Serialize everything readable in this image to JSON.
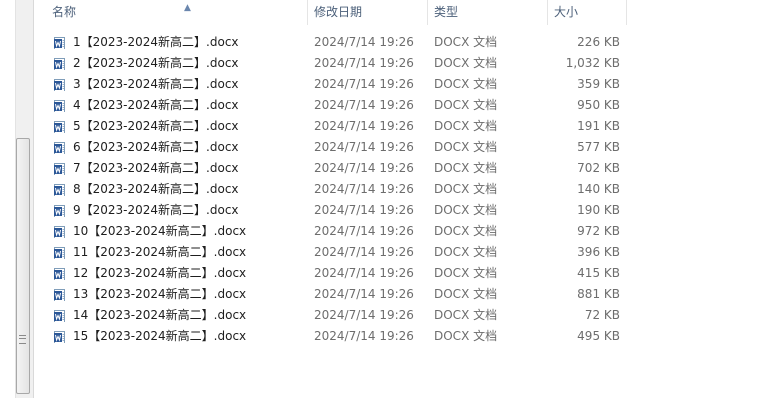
{
  "header": {
    "name_label": "名称",
    "date_label": "修改日期",
    "type_label": "类型",
    "size_label": "大小"
  },
  "files": [
    {
      "name": "1【2023-2024新高二】.docx",
      "date": "2024/7/14 19:26",
      "type": "DOCX 文档",
      "size": "226 KB"
    },
    {
      "name": "2【2023-2024新高二】.docx",
      "date": "2024/7/14 19:26",
      "type": "DOCX 文档",
      "size": "1,032 KB"
    },
    {
      "name": "3【2023-2024新高二】.docx",
      "date": "2024/7/14 19:26",
      "type": "DOCX 文档",
      "size": "359 KB"
    },
    {
      "name": "4【2023-2024新高二】.docx",
      "date": "2024/7/14 19:26",
      "type": "DOCX 文档",
      "size": "950 KB"
    },
    {
      "name": "5【2023-2024新高二】.docx",
      "date": "2024/7/14 19:26",
      "type": "DOCX 文档",
      "size": "191 KB"
    },
    {
      "name": "6【2023-2024新高二】.docx",
      "date": "2024/7/14 19:26",
      "type": "DOCX 文档",
      "size": "577 KB"
    },
    {
      "name": "7【2023-2024新高二】.docx",
      "date": "2024/7/14 19:26",
      "type": "DOCX 文档",
      "size": "702 KB"
    },
    {
      "name": "8【2023-2024新高二】.docx",
      "date": "2024/7/14 19:26",
      "type": "DOCX 文档",
      "size": "140 KB"
    },
    {
      "name": "9【2023-2024新高二】.docx",
      "date": "2024/7/14 19:26",
      "type": "DOCX 文档",
      "size": "190 KB"
    },
    {
      "name": "10【2023-2024新高二】.docx",
      "date": "2024/7/14 19:26",
      "type": "DOCX 文档",
      "size": "972 KB"
    },
    {
      "name": "11【2023-2024新高二】.docx",
      "date": "2024/7/14 19:26",
      "type": "DOCX 文档",
      "size": "396 KB"
    },
    {
      "name": "12【2023-2024新高二】.docx",
      "date": "2024/7/14 19:26",
      "type": "DOCX 文档",
      "size": "415 KB"
    },
    {
      "name": "13【2023-2024新高二】.docx",
      "date": "2024/7/14 19:26",
      "type": "DOCX 文档",
      "size": "881 KB"
    },
    {
      "name": "14【2023-2024新高二】.docx",
      "date": "2024/7/14 19:26",
      "type": "DOCX 文档",
      "size": "72 KB"
    },
    {
      "name": "15【2023-2024新高二】.docx",
      "date": "2024/7/14 19:26",
      "type": "DOCX 文档",
      "size": "495 KB"
    }
  ],
  "icons": {
    "file_icon": "word-document-icon",
    "word_blue": "#2b5797"
  }
}
